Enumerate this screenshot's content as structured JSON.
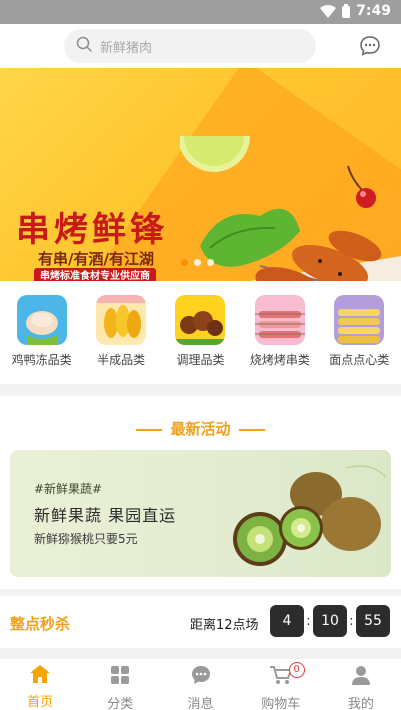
{
  "status_bar": {
    "time": "7:49"
  },
  "search": {
    "placeholder": "新鲜猪肉"
  },
  "banner": {
    "title": "串烤鲜锋",
    "subtitle": "有串/有酒/有江湖",
    "tag": "串烤标准食材专业供应商",
    "slide_count": 3,
    "active_slide": 0
  },
  "categories": [
    {
      "label": "鸡鸭冻品类",
      "icon": "frozen-poultry-icon"
    },
    {
      "label": "半成品类",
      "icon": "semi-finished-icon"
    },
    {
      "label": "调理品类",
      "icon": "seasoned-meat-icon"
    },
    {
      "label": "烧烤烤串类",
      "icon": "bbq-skewer-icon"
    },
    {
      "label": "面点点心类",
      "icon": "pastry-icon"
    }
  ],
  "activity": {
    "heading": "最新活动",
    "hashtag": "#新鲜果蔬#",
    "title": "新鲜果蔬 果园直运",
    "description": "新鲜猕猴桃只要5元"
  },
  "flash_sale": {
    "title": "整点秒杀",
    "countdown_label": "距离12点场",
    "hours": "4",
    "minutes": "10",
    "seconds": "55"
  },
  "tabbar": {
    "items": [
      {
        "label": "首页",
        "icon": "home-icon",
        "active": true
      },
      {
        "label": "分类",
        "icon": "category-icon",
        "active": false
      },
      {
        "label": "消息",
        "icon": "message-icon",
        "active": false
      },
      {
        "label": "购物车",
        "icon": "cart-icon",
        "active": false,
        "badge": "0"
      },
      {
        "label": "我的",
        "icon": "profile-icon",
        "active": false
      }
    ]
  },
  "colors": {
    "accent": "#f6a600",
    "banner_red": "#c8191b",
    "timer_bg": "#2c2c2c"
  }
}
